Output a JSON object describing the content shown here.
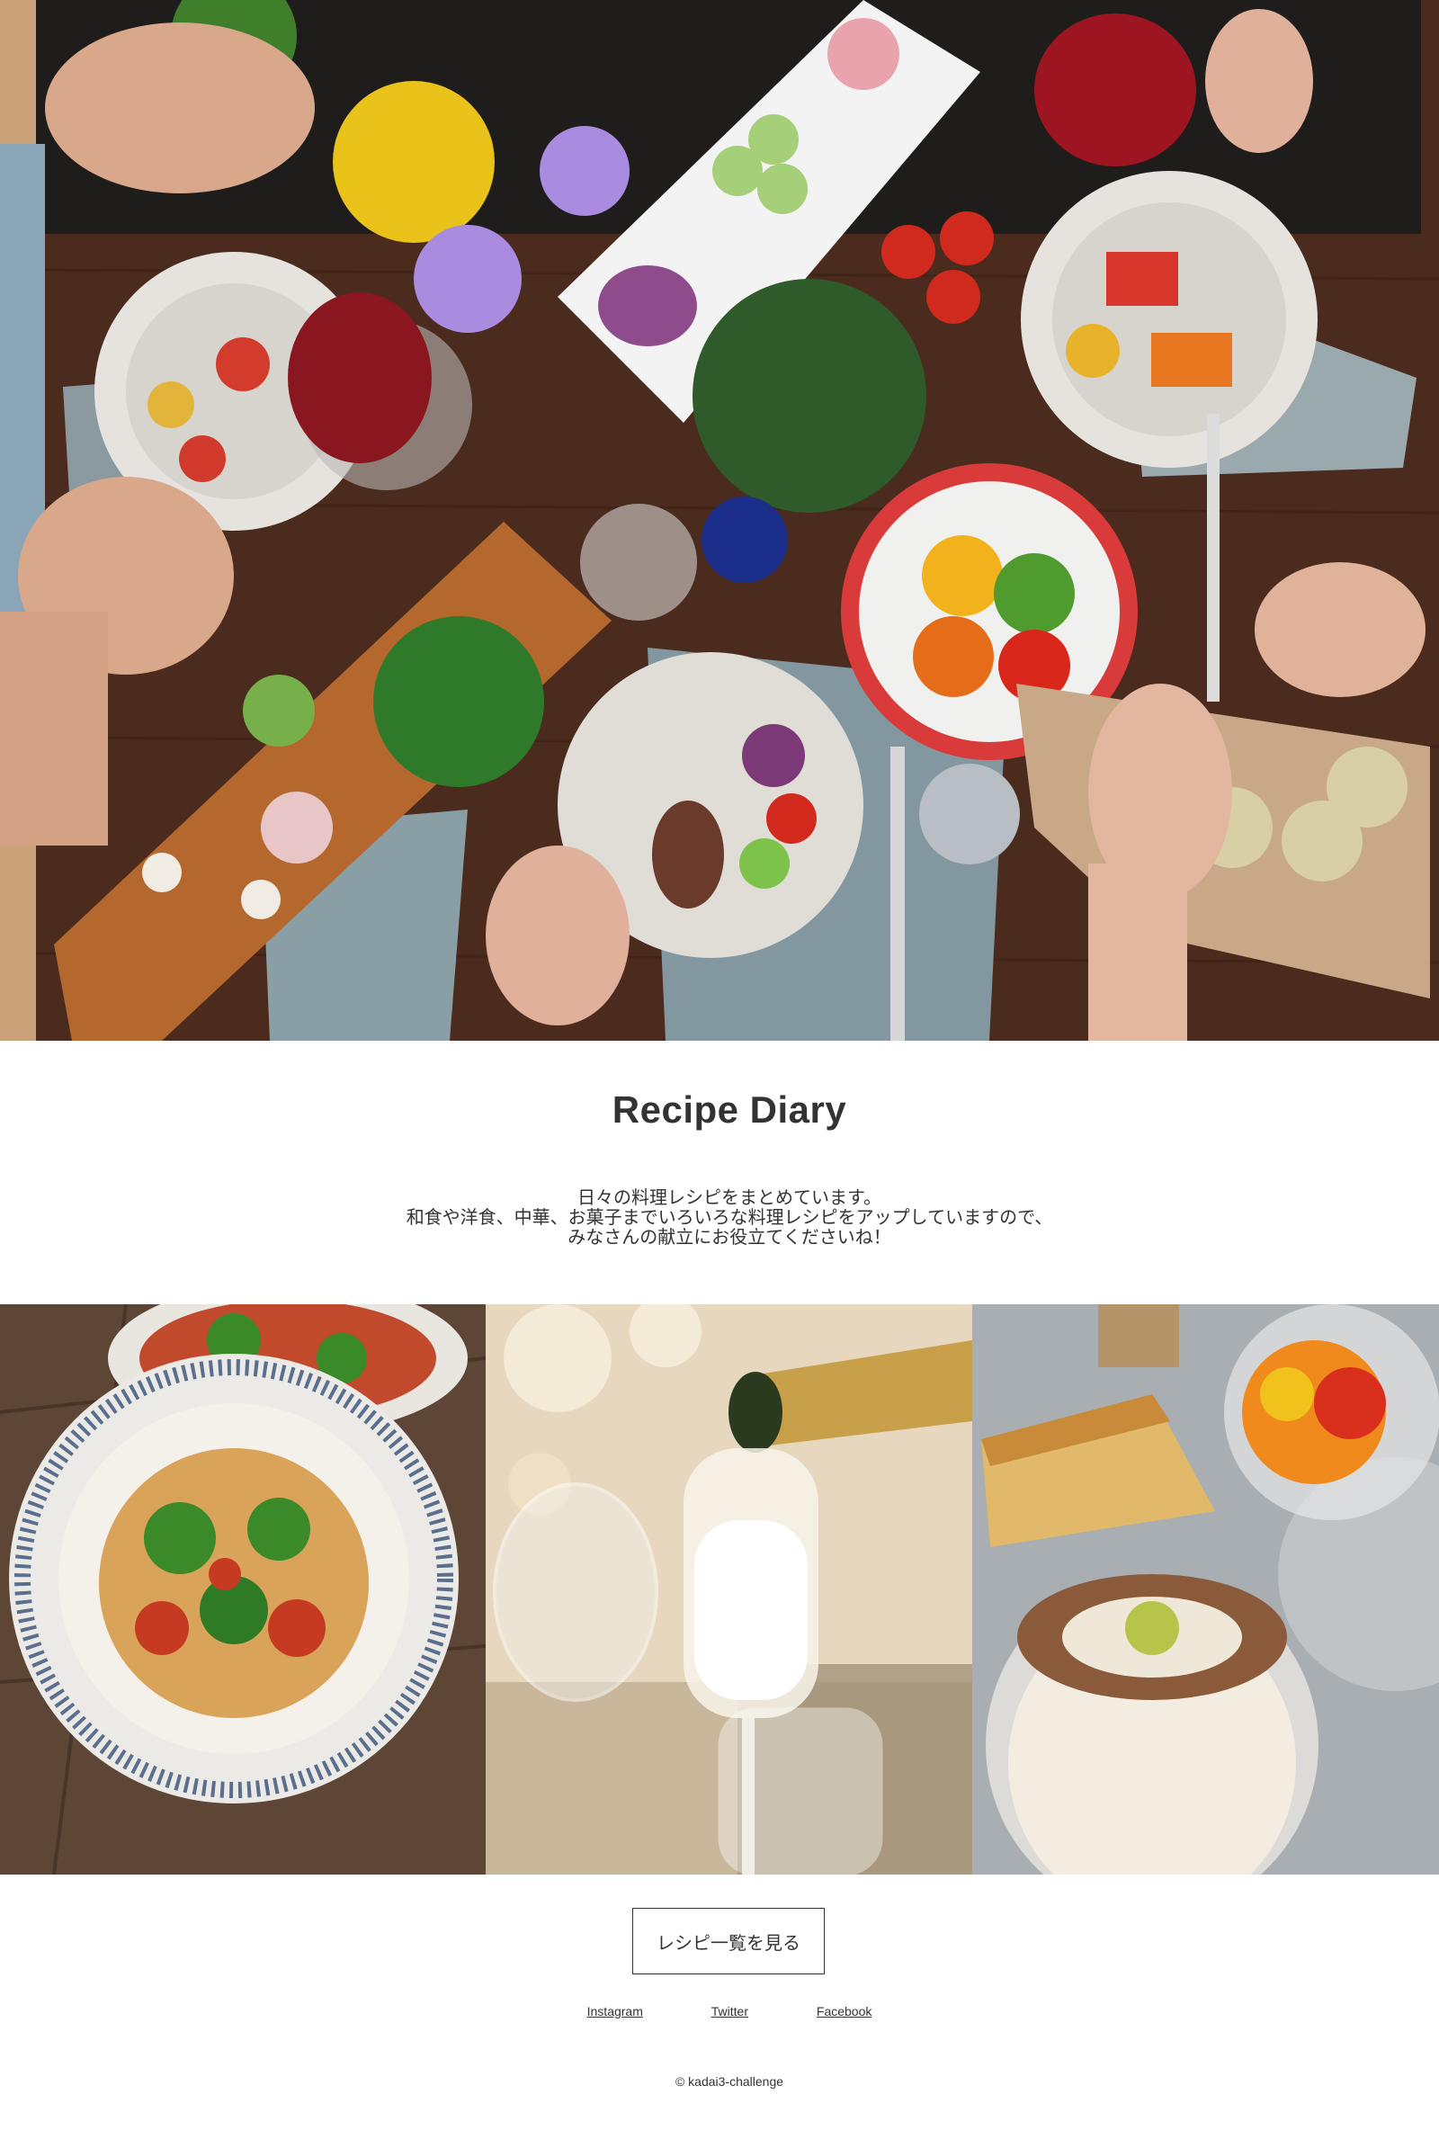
{
  "hero": {
    "image": "hero-image"
  },
  "header": {
    "title": "Recipe Diary"
  },
  "intro": {
    "lines": [
      "日々の料理レシピをまとめています。",
      "和食や洋食、中華、お菓子までいろいろな料理レシピをアップしていますので、",
      "みなさんの献立にお役立てくださいね！"
    ]
  },
  "gallery": {
    "items": [
      "pasta-image",
      "champagne-image",
      "dessert-image"
    ]
  },
  "cta": {
    "label": "レシピ一覧を見る"
  },
  "footer": {
    "links": [
      "Instagram",
      "Twitter",
      "Facebook"
    ],
    "copyright": "© kadai3-challenge"
  },
  "colors": {
    "text": "#333333",
    "background": "#ffffff",
    "table_wood": "#4a2e20"
  }
}
